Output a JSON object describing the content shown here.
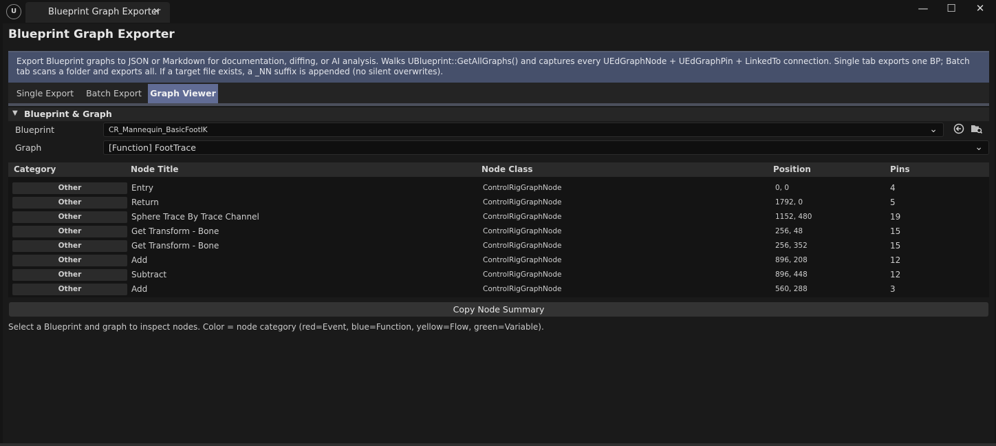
{
  "window": {
    "tab_title": "Blueprint Graph Exporter",
    "tab_close": "×",
    "logo": "U",
    "minimize": "—",
    "maximize": "☐",
    "close": "✕"
  },
  "page_title": "Blueprint Graph Exporter",
  "info": "Export Blueprint graphs to JSON or Markdown for documentation, diffing, or AI analysis. Walks UBlueprint::GetAllGraphs() and captures every UEdGraphNode + UEdGraphPin + LinkedTo connection. Single tab exports one BP; Batch tab scans a folder and exports all. If a target file exists, a _NN suffix is appended (no silent overwrites).",
  "tabs": [
    {
      "label": "Single Export",
      "active": false
    },
    {
      "label": "Batch Export",
      "active": false
    },
    {
      "label": "Graph Viewer",
      "active": true
    }
  ],
  "section": {
    "title": "Blueprint & Graph",
    "blueprint_label": "Blueprint",
    "blueprint_value": "CR_Mannequin_BasicFootIK",
    "graph_label": "Graph",
    "graph_value": "[Function] FootTrace",
    "icons": [
      "use-selected-icon",
      "browse-asset-icon"
    ]
  },
  "table": {
    "headers": {
      "category": "Category",
      "title": "Node Title",
      "class": "Node Class",
      "position": "Position",
      "pins": "Pins"
    },
    "rows": [
      {
        "category": "Other",
        "title": "Entry",
        "class": "ControlRigGraphNode",
        "position": "0, 0",
        "pins": "4"
      },
      {
        "category": "Other",
        "title": "Return",
        "class": "ControlRigGraphNode",
        "position": "1792, 0",
        "pins": "5"
      },
      {
        "category": "Other",
        "title": "Sphere Trace By Trace Channel",
        "class": "ControlRigGraphNode",
        "position": "1152, 480",
        "pins": "19"
      },
      {
        "category": "Other",
        "title": "Get Transform - Bone",
        "class": "ControlRigGraphNode",
        "position": "256, 48",
        "pins": "15"
      },
      {
        "category": "Other",
        "title": "Get Transform - Bone",
        "class": "ControlRigGraphNode",
        "position": "256, 352",
        "pins": "15"
      },
      {
        "category": "Other",
        "title": "Add",
        "class": "ControlRigGraphNode",
        "position": "896, 208",
        "pins": "12"
      },
      {
        "category": "Other",
        "title": "Subtract",
        "class": "ControlRigGraphNode",
        "position": "896, 448",
        "pins": "12"
      },
      {
        "category": "Other",
        "title": "Add",
        "class": "ControlRigGraphNode",
        "position": "560, 288",
        "pins": "3"
      }
    ]
  },
  "copy_button": "Copy Node Summary",
  "status": "Select a Blueprint and graph to inspect nodes. Color = node category (red=Event, blue=Function, yellow=Flow, green=Variable)."
}
